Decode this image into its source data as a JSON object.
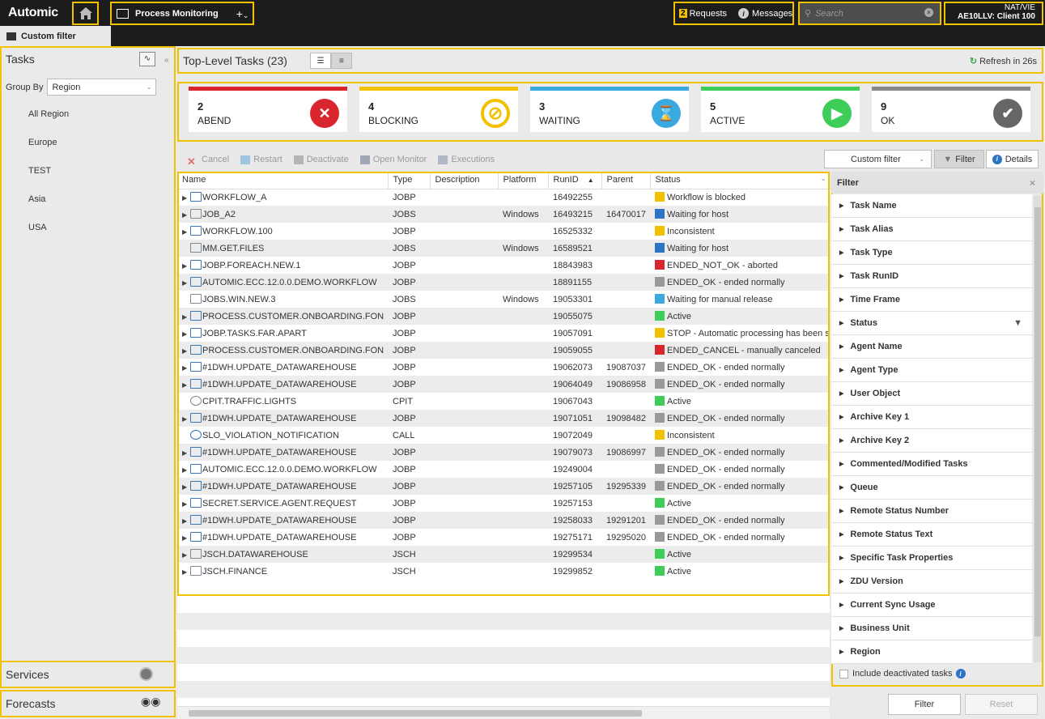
{
  "top": {
    "logo": "Automic",
    "perspective": "Process Monitoring",
    "add": "+",
    "requests_count": "2",
    "requests_label": "Requests",
    "messages_label": "Messages",
    "search_placeholder": "Search",
    "user_line1": "NAT/VIE",
    "user_line2": "AE10LLV: Client 100"
  },
  "left": {
    "tab_label": "Custom filter",
    "tasks_title": "Tasks",
    "groupby_label": "Group By",
    "groupby_value": "Region",
    "regions": [
      "All Region",
      "Europe",
      "TEST",
      "Asia",
      "USA"
    ],
    "services_label": "Services",
    "forecasts_label": "Forecasts"
  },
  "main": {
    "title": "Top-Level Tasks (23)",
    "refresh": "Refresh in 26s"
  },
  "status_cards": [
    {
      "count": "2",
      "label": "ABEND",
      "color": "#d9262e",
      "icon": "x-circle-icon"
    },
    {
      "count": "4",
      "label": "BLOCKING",
      "color": "#f2c200",
      "icon": "blocked-icon"
    },
    {
      "count": "3",
      "label": "WAITING",
      "color": "#39a9e0",
      "icon": "hourglass-icon"
    },
    {
      "count": "5",
      "label": "ACTIVE",
      "color": "#3dcd58",
      "icon": "play-icon"
    },
    {
      "count": "9",
      "label": "OK",
      "color": "#888888",
      "icon": "check-icon"
    }
  ],
  "actions": {
    "cancel": "Cancel",
    "restart": "Restart",
    "deactivate": "Deactivate",
    "open_monitor": "Open Monitor",
    "executions": "Executions",
    "custom_filter": "Custom filter",
    "filter": "Filter",
    "details": "Details"
  },
  "table": {
    "columns": [
      "Name",
      "Type",
      "Description",
      "Platform",
      "RunID",
      "Parent",
      "Status"
    ],
    "rows": [
      {
        "exp": true,
        "name": "WORKFLOW_A",
        "type": "JOBP",
        "desc": "",
        "platform": "",
        "runid": "16492255",
        "parent": "",
        "status": "Workflow is blocked",
        "scolor": "#f2c200"
      },
      {
        "exp": true,
        "name": "JOB_A2",
        "type": "JOBS",
        "desc": "",
        "platform": "Windows",
        "runid": "16493215",
        "parent": "16470017",
        "status": "Waiting for host",
        "scolor": "#2d73c6"
      },
      {
        "exp": true,
        "name": "WORKFLOW.100",
        "type": "JOBP",
        "desc": "",
        "platform": "",
        "runid": "16525332",
        "parent": "",
        "status": "Inconsistent",
        "scolor": "#f2c200"
      },
      {
        "exp": false,
        "name": "MM.GET.FILES",
        "type": "JOBS",
        "desc": "",
        "platform": "Windows",
        "runid": "16589521",
        "parent": "",
        "status": "Waiting for host",
        "scolor": "#2d73c6"
      },
      {
        "exp": true,
        "name": "JOBP.FOREACH.NEW.1",
        "type": "JOBP",
        "desc": "",
        "platform": "",
        "runid": "18843983",
        "parent": "",
        "status": "ENDED_NOT_OK - aborted",
        "scolor": "#d9262e"
      },
      {
        "exp": true,
        "name": "AUTOMIC.ECC.12.0.0.DEMO.WORKFLOW",
        "type": "JOBP",
        "desc": "",
        "platform": "",
        "runid": "18891155",
        "parent": "",
        "status": "ENDED_OK - ended normally",
        "scolor": "#999999"
      },
      {
        "exp": false,
        "name": "JOBS.WIN.NEW.3",
        "type": "JOBS",
        "desc": "",
        "platform": "Windows",
        "runid": "19053301",
        "parent": "",
        "status": "Waiting for manual release",
        "scolor": "#39a9e0"
      },
      {
        "exp": true,
        "name": "PROCESS.CUSTOMER.ONBOARDING.FON",
        "type": "JOBP",
        "desc": "",
        "platform": "",
        "runid": "19055075",
        "parent": "",
        "status": "Active",
        "scolor": "#3dcd58"
      },
      {
        "exp": true,
        "name": "JOBP.TASKS.FAR.APART",
        "type": "JOBP",
        "desc": "",
        "platform": "",
        "runid": "19057091",
        "parent": "",
        "status": "STOP - Automatic processing has been sto",
        "scolor": "#f2c200"
      },
      {
        "exp": true,
        "name": "PROCESS.CUSTOMER.ONBOARDING.FON",
        "type": "JOBP",
        "desc": "",
        "platform": "",
        "runid": "19059055",
        "parent": "",
        "status": "ENDED_CANCEL - manually canceled",
        "scolor": "#d9262e"
      },
      {
        "exp": true,
        "name": "#1DWH.UPDATE_DATAWAREHOUSE",
        "type": "JOBP",
        "desc": "",
        "platform": "",
        "runid": "19062073",
        "parent": "19087037",
        "status": "ENDED_OK - ended normally",
        "scolor": "#999999"
      },
      {
        "exp": true,
        "name": "#1DWH.UPDATE_DATAWAREHOUSE",
        "type": "JOBP",
        "desc": "",
        "platform": "",
        "runid": "19064049",
        "parent": "19086958",
        "status": "ENDED_OK - ended normally",
        "scolor": "#999999"
      },
      {
        "exp": false,
        "name": "CPIT.TRAFFIC.LIGHTS",
        "type": "CPIT",
        "desc": "",
        "platform": "",
        "runid": "19067043",
        "parent": "",
        "status": "Active",
        "scolor": "#3dcd58"
      },
      {
        "exp": true,
        "name": "#1DWH.UPDATE_DATAWAREHOUSE",
        "type": "JOBP",
        "desc": "",
        "platform": "",
        "runid": "19071051",
        "parent": "19098482",
        "status": "ENDED_OK - ended normally",
        "scolor": "#999999"
      },
      {
        "exp": false,
        "name": "SLO_VIOLATION_NOTIFICATION",
        "type": "CALL",
        "desc": "",
        "platform": "",
        "runid": "19072049",
        "parent": "",
        "status": "Inconsistent",
        "scolor": "#f2c200"
      },
      {
        "exp": true,
        "name": "#1DWH.UPDATE_DATAWAREHOUSE",
        "type": "JOBP",
        "desc": "",
        "platform": "",
        "runid": "19079073",
        "parent": "19086997",
        "status": "ENDED_OK - ended normally",
        "scolor": "#999999"
      },
      {
        "exp": true,
        "name": "AUTOMIC.ECC.12.0.0.DEMO.WORKFLOW",
        "type": "JOBP",
        "desc": "",
        "platform": "",
        "runid": "19249004",
        "parent": "",
        "status": "ENDED_OK - ended normally",
        "scolor": "#999999"
      },
      {
        "exp": true,
        "name": "#1DWH.UPDATE_DATAWAREHOUSE",
        "type": "JOBP",
        "desc": "",
        "platform": "",
        "runid": "19257105",
        "parent": "19295339",
        "status": "ENDED_OK - ended normally",
        "scolor": "#999999"
      },
      {
        "exp": true,
        "name": "SECRET.SERVICE.AGENT.REQUEST",
        "type": "JOBP",
        "desc": "",
        "platform": "",
        "runid": "19257153",
        "parent": "",
        "status": "Active",
        "scolor": "#3dcd58"
      },
      {
        "exp": true,
        "name": "#1DWH.UPDATE_DATAWAREHOUSE",
        "type": "JOBP",
        "desc": "",
        "platform": "",
        "runid": "19258033",
        "parent": "19291201",
        "status": "ENDED_OK - ended normally",
        "scolor": "#999999"
      },
      {
        "exp": true,
        "name": "#1DWH.UPDATE_DATAWAREHOUSE",
        "type": "JOBP",
        "desc": "",
        "platform": "",
        "runid": "19275171",
        "parent": "19295020",
        "status": "ENDED_OK - ended normally",
        "scolor": "#999999"
      },
      {
        "exp": true,
        "name": "JSCH.DATAWAREHOUSE",
        "type": "JSCH",
        "desc": "",
        "platform": "",
        "runid": "19299534",
        "parent": "",
        "status": "Active",
        "scolor": "#3dcd58"
      },
      {
        "exp": true,
        "name": "JSCH.FINANCE",
        "type": "JSCH",
        "desc": "",
        "platform": "",
        "runid": "19299852",
        "parent": "",
        "status": "Active",
        "scolor": "#3dcd58"
      }
    ]
  },
  "filter": {
    "title": "Filter",
    "items": [
      "Task Name",
      "Task Alias",
      "Task Type",
      "Task RunID",
      "Time Frame",
      "Status",
      "Agent Name",
      "Agent Type",
      "User Object",
      "Archive Key 1",
      "Archive Key 2",
      "Commented/Modified Tasks",
      "Queue",
      "Remote Status Number",
      "Remote Status Text",
      "Specific Task Properties",
      "ZDU Version",
      "Current Sync Usage",
      "Business Unit",
      "Region"
    ],
    "include_deactivated": "Include deactivated tasks",
    "filter_btn": "Filter",
    "reset_btn": "Reset"
  }
}
